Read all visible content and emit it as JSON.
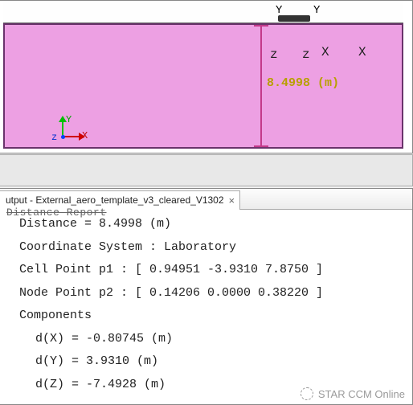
{
  "viewport": {
    "top_labels": {
      "y1": "Y",
      "y2": "Y"
    },
    "scene_labels": {
      "z1": "z",
      "z2": "z",
      "x1": "X",
      "x2": "X"
    },
    "ruler_value": "8.4998 (m)",
    "triad": {
      "x": "X",
      "y": "Y",
      "z": "z"
    }
  },
  "output": {
    "tab_title": "utput - External_aero_template_v3_cleared_V1302",
    "header": "Distance Report",
    "lines": {
      "distance": "Distance = 8.4998 (m)",
      "coord_sys": "Coordinate System : Laboratory",
      "p1": "Cell Point p1 : [ 0.94951 -3.9310 7.8750 ]",
      "p2": "Node Point p2 : [ 0.14206 0.0000 0.38220 ]",
      "components": "Components",
      "dx": "d(X) = -0.80745 (m)",
      "dy": "d(Y) = 3.9310 (m)",
      "dz": "d(Z) = -7.4928 (m)"
    }
  },
  "watermark": "STAR CCM Online"
}
